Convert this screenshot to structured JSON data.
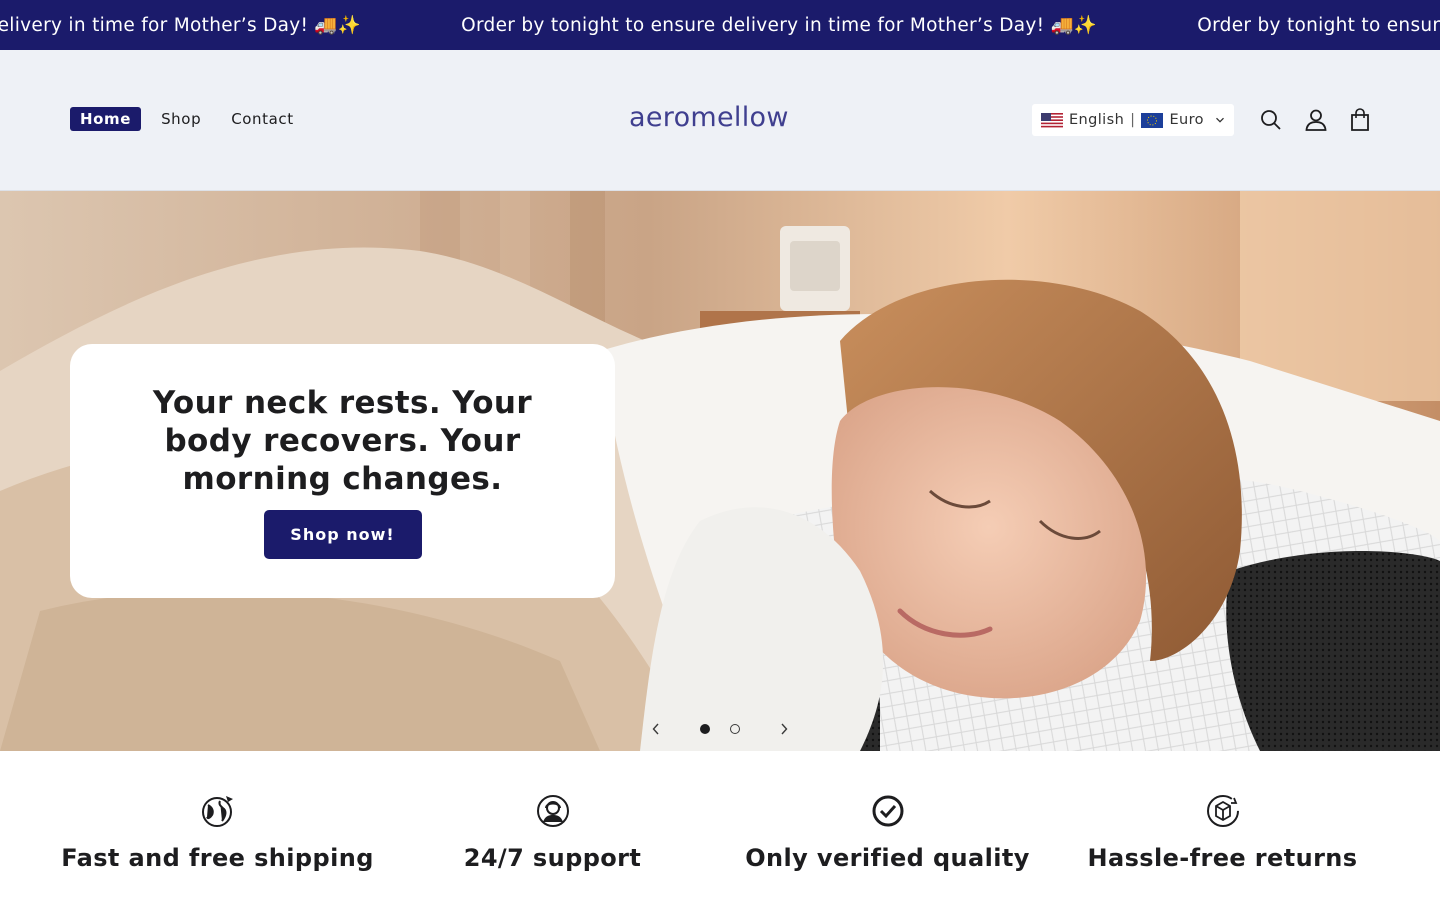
{
  "announcement": {
    "partial": "for Mother’s Day! 🚚✨",
    "message": "Order by tonight to ensure delivery in time for Mother’s Day! 🚚✨",
    "message_cut": "Order by tonight to ensure delivery in"
  },
  "nav": {
    "home": "Home",
    "shop": "Shop",
    "contact": "Contact"
  },
  "logo": "aeromellow",
  "locale": {
    "language": "English",
    "separator": "|",
    "currency": "Euro"
  },
  "hero": {
    "headline": "Your neck rests. Your body recovers. Your morning changes.",
    "cta": "Shop now!",
    "slides": 2,
    "active_slide": 1
  },
  "features": [
    {
      "label": "Fast and free shipping",
      "icon": "globe-plane-icon"
    },
    {
      "label": "24/7 support",
      "icon": "support-agent-icon"
    },
    {
      "label": "Only verified quality",
      "icon": "check-badge-icon"
    },
    {
      "label": "Hassle-free returns",
      "icon": "return-box-icon"
    }
  ],
  "colors": {
    "brand": "#1b1b6b",
    "header_bg": "#eef1f6",
    "logo": "#3f3f8f"
  }
}
